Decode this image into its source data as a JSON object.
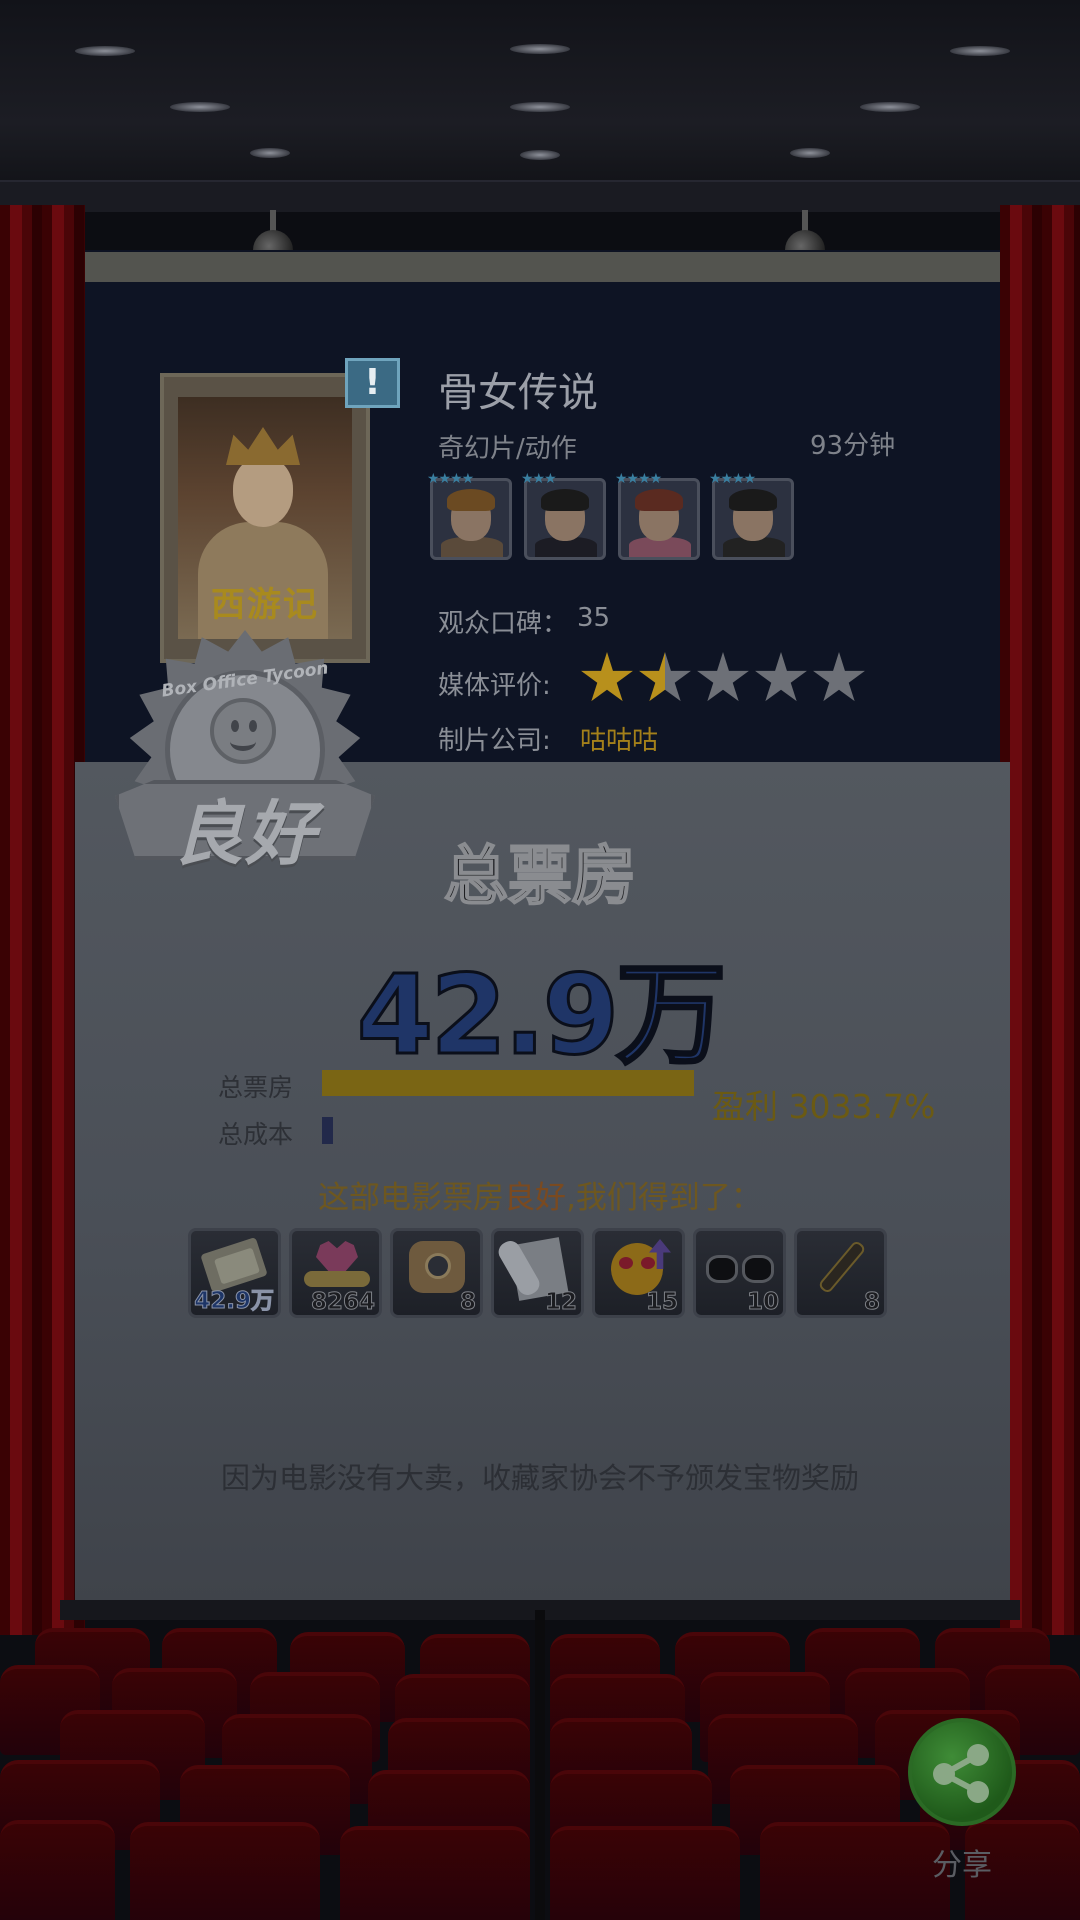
{
  "movie": {
    "poster_title": "西游记",
    "title": "骨女传说",
    "genre": "奇幻片/动作",
    "duration": "93分钟",
    "alert_badge": "!",
    "cast": [
      {
        "stars": "★★★★",
        "star_count": 4,
        "hair": "#6b4a22",
        "body": "#5a4a3a"
      },
      {
        "stars": "★★★",
        "star_count": 3,
        "hair": "#1a1a1a",
        "body": "#1c1c24"
      },
      {
        "stars": "★★★★",
        "star_count": 4,
        "hair": "#5a2a20",
        "body": "#7a4a5a"
      },
      {
        "stars": "★★★★",
        "star_count": 4,
        "hair": "#1a1a1a",
        "body": "#222"
      }
    ],
    "audience_label": "观众口碑：",
    "audience_score": "35",
    "media_label": "媒体评价:",
    "media_rating": 1.5,
    "media_rating_max": 5,
    "company_label": "制片公司:",
    "company": "咕咕咕"
  },
  "seal": {
    "brand": "Box Office Tycoon",
    "grade": "良好"
  },
  "results": {
    "title": "总票房",
    "total_box_office": "42.9万",
    "revenue_label": "总票房",
    "cost_label": "总成本",
    "profit": "盈利 3033.7%",
    "reward_prefix": "这部电影票房",
    "reward_highlight": "良好",
    "reward_suffix": ",我们得到了：",
    "items": [
      {
        "icon": "money-icon",
        "count": "42.9万"
      },
      {
        "icon": "heart-hands-icon",
        "count": "8264"
      },
      {
        "icon": "film-reel-icon",
        "count": "8"
      },
      {
        "icon": "script-icon",
        "count": "12"
      },
      {
        "icon": "love-eyes-emoji-icon",
        "count": "15"
      },
      {
        "icon": "sunglasses-icon",
        "count": "10"
      },
      {
        "icon": "fountain-pen-icon",
        "count": "8"
      }
    ],
    "notice": "因为电影没有大卖，收藏家协会不予颁发宝物奖励"
  },
  "share": {
    "label": "分享",
    "icon": "share-icon"
  },
  "colors": {
    "accent_gold": "#a4801a",
    "value_blue": "#1f3567",
    "share_green": "#2b6a25"
  }
}
